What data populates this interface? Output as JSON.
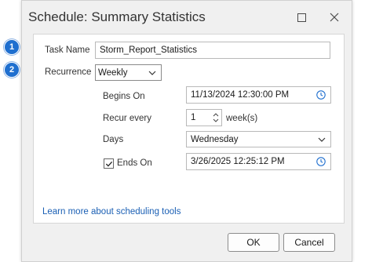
{
  "window": {
    "title": "Schedule: Summary Statistics"
  },
  "badges": [
    "1",
    "2"
  ],
  "form": {
    "task_name_label": "Task Name",
    "task_name_value": "Storm_Report_Statistics",
    "recurrence_label": "Recurrence",
    "recurrence_value": "Weekly",
    "begins_on_label": "Begins On",
    "begins_on_value": "11/13/2024 12:30:00 PM",
    "recur_every_label": "Recur every",
    "recur_every_value": "1",
    "recur_every_unit": "week(s)",
    "days_label": "Days",
    "days_value": "Wednesday",
    "ends_on_label": "Ends On",
    "ends_on_checked": true,
    "ends_on_value": "3/26/2025 12:25:12 PM"
  },
  "help_link": "Learn more about scheduling tools",
  "buttons": {
    "ok": "OK",
    "cancel": "Cancel"
  },
  "colors": {
    "badge": "#1f6fcf",
    "link": "#1a5fb4",
    "clock_icon": "#1f6fcf"
  }
}
